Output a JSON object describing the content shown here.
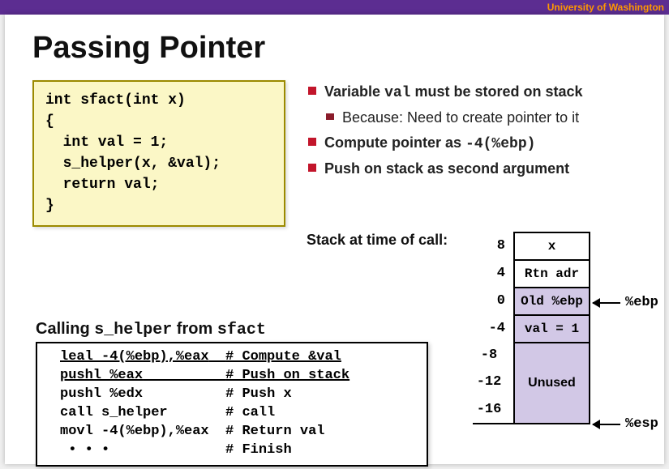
{
  "header": {
    "institution": "University of Washington"
  },
  "title": "Passing Pointer",
  "code1": "int sfact(int x)\n{\n  int val = 1;\n  s_helper(x, &val);\n  return val;\n}",
  "bullets": {
    "b1_pre": "Variable ",
    "b1_code": "val",
    "b1_post": " must be stored on stack",
    "b1a": "Because: Need to create pointer to it",
    "b2_pre": "Compute pointer as ",
    "b2_code": "-4(%ebp)",
    "b3": "Push on stack as second argument"
  },
  "stack": {
    "caption": "Stack at time of call:",
    "rows": [
      {
        "offset": "8",
        "label": "x",
        "style": "plain"
      },
      {
        "offset": "4",
        "label": "Rtn adr",
        "style": "plain"
      },
      {
        "offset": "0",
        "label": "Old %ebp",
        "style": "purple"
      },
      {
        "offset": "-4",
        "label": "val = 1",
        "style": "purple"
      }
    ],
    "tall_offsets": [
      "-8",
      "-12",
      "-16"
    ],
    "tall_label": "Unused",
    "ptr_ebp": "%ebp",
    "ptr_esp": "%esp"
  },
  "subtitle": {
    "pre": "Calling ",
    "fn": "s_helper",
    "mid": " from ",
    "ctx": "sfact"
  },
  "code2": {
    "l1_a": "leal -4(%ebp),%eax",
    "l1_b": "# Compute &val",
    "l2_a": "pushl %eax",
    "l2_b": "# Push on stack",
    "l3_a": "pushl %edx",
    "l3_b": "# Push x",
    "l4_a": "call s_helper",
    "l4_b": "# call",
    "l5_a": "movl -4(%ebp),%eax",
    "l5_b": "# Return val",
    "l6_a": " • • •",
    "l6_b": "# Finish"
  }
}
